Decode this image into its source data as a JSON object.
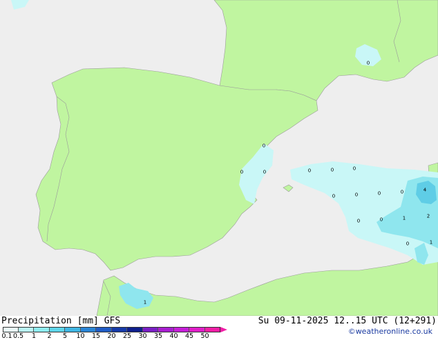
{
  "title": "Precipitation [mm]",
  "model": "GFS",
  "valid_time": "Su 09-11-2025 12..15 UTC (12+291)",
  "credit": "©weatheronline.co.uk",
  "legend": {
    "labels": [
      "0.1",
      "0.5",
      "1",
      "2",
      "5",
      "10",
      "15",
      "20",
      "25",
      "30",
      "35",
      "40",
      "45",
      "50"
    ],
    "colors": [
      "#e9fdfd",
      "#b9f6f6",
      "#8eecf0",
      "#5ed6ea",
      "#3fb6e3",
      "#2a85d6",
      "#1f5bc4",
      "#163aa8",
      "#0f1f8c",
      "#7a1ec4",
      "#a81ed0",
      "#c61ed8",
      "#e01ec8",
      "#f21ea6"
    ]
  },
  "colors": {
    "land": "#c0f5a0",
    "sea": "#eeeeee",
    "border": "#9a9a9a",
    "precip_light": "#c9f7f7",
    "precip_mid": "#8fe6ee",
    "precip_high": "#5fcde6"
  },
  "markers": [
    "0",
    "0",
    "0",
    "0",
    "0",
    "0",
    "0",
    "0",
    "0",
    "0",
    "0",
    "0",
    "0",
    "1",
    "2",
    "4",
    "1",
    "0",
    "1"
  ]
}
